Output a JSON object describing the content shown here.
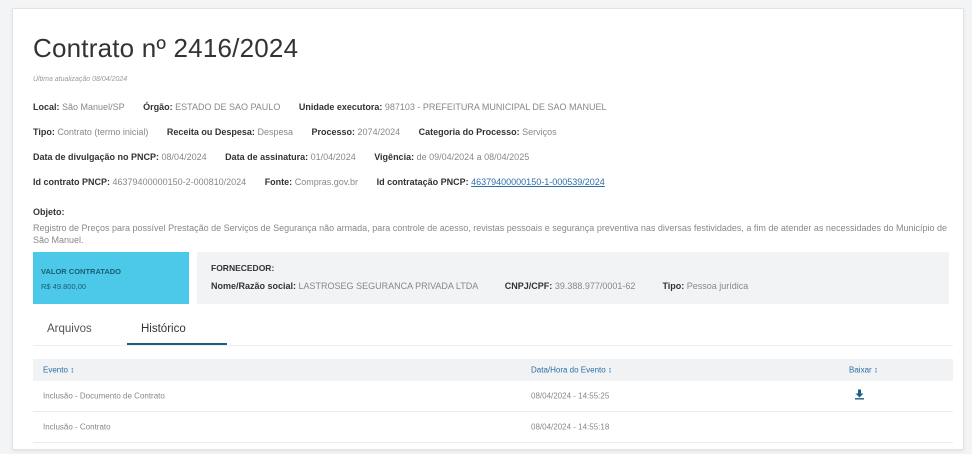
{
  "header": {
    "title": "Contrato nº 2416/2024",
    "updated": "Última atualização 08/04/2024"
  },
  "details": {
    "local_label": "Local:",
    "local_value": "São Manuel/SP",
    "orgao_label": "Órgão:",
    "orgao_value": "ESTADO DE SAO PAULO",
    "unidade_label": "Unidade executora:",
    "unidade_value": "987103 - PREFEITURA MUNICIPAL DE SAO MANUEL",
    "tipo_label": "Tipo:",
    "tipo_value": "Contrato (termo inicial)",
    "receita_label": "Receita ou Despesa:",
    "receita_value": "Despesa",
    "processo_label": "Processo:",
    "processo_value": "2074/2024",
    "categoria_label": "Categoria do Processo:",
    "categoria_value": "Serviços",
    "divulgacao_label": "Data de divulgação no PNCP:",
    "divulgacao_value": "08/04/2024",
    "assinatura_label": "Data de assinatura:",
    "assinatura_value": "01/04/2024",
    "vigencia_label": "Vigência:",
    "vigencia_value": "de 09/04/2024 a 08/04/2025",
    "idcontrato_label": "Id contrato PNCP:",
    "idcontrato_value": "46379400000150-2-000810/2024",
    "fonte_label": "Fonte:",
    "fonte_value": "Compras.gov.br",
    "idcontratacao_label": "Id contratação PNCP:",
    "idcontratacao_value": "46379400000150-1-000539/2024"
  },
  "objeto": {
    "label": "Objeto:",
    "text": "Registro de Preços para possível Prestação de Serviços de Segurança não armada, para controle de acesso, revistas pessoais e segurança preventiva nas diversas festividades, a fim de atender as necessidades do Município de São Manuel."
  },
  "valor": {
    "label": "VALOR CONTRATADO",
    "amount": "R$ 49.800,00"
  },
  "fornecedor": {
    "label": "FORNECEDOR:",
    "nome_label": "Nome/Razão social:",
    "nome_value": "LASTROSEG SEGURANCA PRIVADA LTDA",
    "cnpj_label": "CNPJ/CPF:",
    "cnpj_value": "39.388.977/0001-62",
    "tipo_label": "Tipo:",
    "tipo_value": "Pessoa jurídica"
  },
  "tabs": {
    "arquivos": "Arquivos",
    "historico": "Histórico"
  },
  "table": {
    "headers": {
      "evento": "Evento ↕",
      "data": "Data/Hora do Evento ↕",
      "baixar": "Baixar ↕"
    },
    "rows": [
      {
        "evento": "Inclusão - Documento de Contrato",
        "data": "08/04/2024 - 14:55:25",
        "has_download": true
      },
      {
        "evento": "Inclusão - Contrato",
        "data": "08/04/2024 - 14:55:18",
        "has_download": false
      }
    ]
  },
  "icons": {
    "download": "download-icon"
  },
  "colors": {
    "accent": "#1b5f84",
    "valor_bg": "#4cc8e8",
    "link": "#2b6ea8"
  }
}
